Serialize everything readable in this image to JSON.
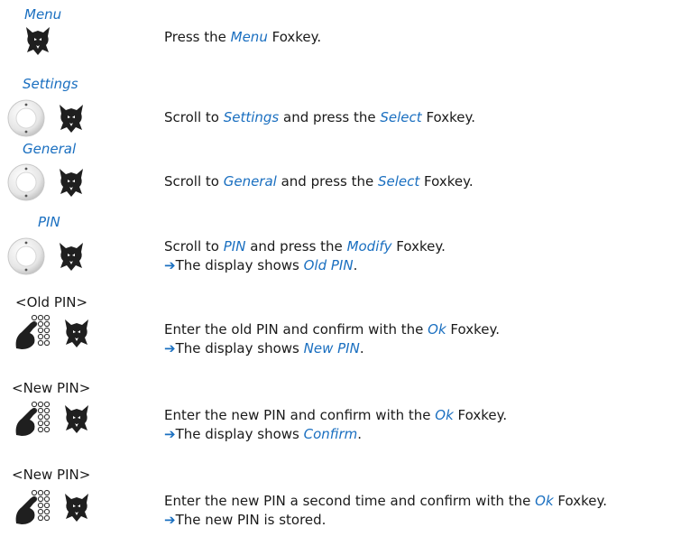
{
  "steps": [
    {
      "label": "Menu",
      "label_style": "italic",
      "icons": [
        "fox-icon"
      ],
      "line1": {
        "pre": "Press the ",
        "key1": "Menu",
        "mid": " Foxkey.",
        "key2": "",
        "post": ""
      },
      "line2": null
    },
    {
      "label": "Settings",
      "label_style": "italic",
      "icons": [
        "navigation-key-icon",
        "fox-icon"
      ],
      "line1": {
        "pre": "Scroll to ",
        "key1": "Settings",
        "mid": " and press the ",
        "key2": "Select",
        "post": " Foxkey."
      },
      "line2": null
    },
    {
      "label": "General",
      "label_style": "italic",
      "icons": [
        "navigation-key-icon",
        "fox-icon"
      ],
      "line1": {
        "pre": "Scroll to ",
        "key1": "General",
        "mid": " and press the ",
        "key2": "Select",
        "post": " Foxkey."
      },
      "line2": null
    },
    {
      "label": "PIN",
      "label_style": "italic",
      "icons": [
        "navigation-key-icon",
        "fox-icon"
      ],
      "line1": {
        "pre": "Scroll to ",
        "key1": "PIN",
        "mid": " and press the ",
        "key2": "Modify",
        "post": " Foxkey."
      },
      "line2": {
        "arrow": "➔",
        "pre": "The display shows ",
        "key": "Old PIN",
        "post": "."
      }
    },
    {
      "label": "<Old PIN>",
      "label_style": "plain",
      "icons": [
        "keypad-icon",
        "fox-icon"
      ],
      "line1": {
        "pre": "Enter the old PIN and confirm with the ",
        "key1": "Ok",
        "mid": " Foxkey.",
        "key2": "",
        "post": ""
      },
      "line2": {
        "arrow": "➔",
        "pre": "The display shows ",
        "key": "New PIN",
        "post": "."
      }
    },
    {
      "label": "<New PIN>",
      "label_style": "plain",
      "icons": [
        "keypad-icon",
        "fox-icon"
      ],
      "line1": {
        "pre": "Enter the new PIN and confirm with the ",
        "key1": "Ok",
        "mid": " Foxkey.",
        "key2": "",
        "post": ""
      },
      "line2": {
        "arrow": "➔",
        "pre": "The display shows ",
        "key": "Confirm",
        "post": "."
      }
    },
    {
      "label": "<New PIN>",
      "label_style": "plain",
      "icons": [
        "keypad-icon",
        "fox-icon"
      ],
      "line1": {
        "pre": "Enter the new PIN a second time and confirm with the ",
        "key1": "Ok",
        "mid": " Foxkey.",
        "key2": "",
        "post": ""
      },
      "line2": {
        "arrow": "➔",
        "pre": "The new PIN is stored.",
        "key": "",
        "post": ""
      }
    }
  ]
}
